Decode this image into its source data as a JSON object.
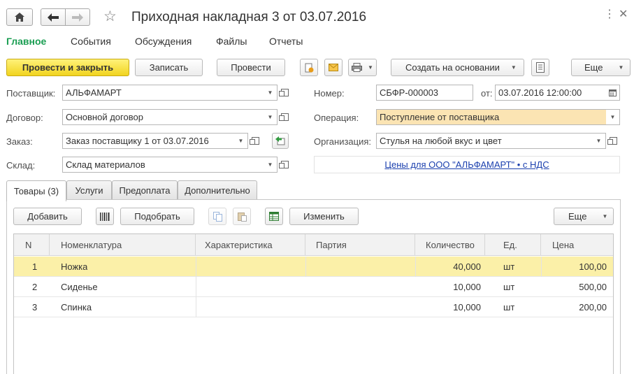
{
  "window": {
    "title": "Приходная накладная 3 от 03.07.2016"
  },
  "top_tabs": [
    "Главное",
    "События",
    "Обсуждения",
    "Файлы",
    "Отчеты"
  ],
  "toolbar": {
    "post_close": "Провести и закрыть",
    "save": "Записать",
    "post": "Провести",
    "create_based": "Создать на основании",
    "more": "Еще"
  },
  "form": {
    "supplier_label": "Поставщик:",
    "supplier_value": "АЛЬФАМАРТ",
    "contract_label": "Договор:",
    "contract_value": "Основной договор",
    "order_label": "Заказ:",
    "order_value": "Заказ поставщику 1 от 03.07.2016",
    "warehouse_label": "Склад:",
    "warehouse_value": "Склад материалов",
    "number_label": "Номер:",
    "number_value": "СБФР-000003",
    "date_label": "от:",
    "date_value": "03.07.2016 12:00:00",
    "operation_label": "Операция:",
    "operation_value": "Поступление от поставщика",
    "organization_label": "Организация:",
    "organization_value": "Стулья на любой вкус и цвет",
    "prices_link": "Цены для ООО \"АЛЬФАМАРТ\" • с НДС"
  },
  "tabs": [
    "Товары (3)",
    "Услуги",
    "Предоплата",
    "Дополнительно"
  ],
  "goods_toolbar": {
    "add": "Добавить",
    "pick": "Подобрать",
    "change": "Изменить",
    "more": "Еще"
  },
  "table": {
    "columns": [
      "N",
      "Номенклатура",
      "Характеристика",
      "Партия",
      "Количество",
      "Ед.",
      "Цена"
    ],
    "rows": [
      {
        "n": "1",
        "item": "Ножка",
        "char": "",
        "batch": "",
        "qty": "40,000",
        "unit": "шт",
        "price": "100,00"
      },
      {
        "n": "2",
        "item": "Сиденье",
        "char": "",
        "batch": "",
        "qty": "10,000",
        "unit": "шт",
        "price": "500,00"
      },
      {
        "n": "3",
        "item": "Спинка",
        "char": "",
        "batch": "",
        "qty": "10,000",
        "unit": "шт",
        "price": "200,00"
      }
    ]
  },
  "colors": {
    "accent_green": "#1a9e52",
    "primary_yellow": "#f1d41f",
    "selected_row": "#fbf0a8",
    "highlight_field": "#fbe4b3",
    "link": "#1a3fae"
  },
  "icons": [
    "home-icon",
    "back-arrow-icon",
    "forward-arrow-icon",
    "star-icon",
    "more-vertical-icon",
    "close-icon",
    "attach-icon",
    "mail-icon",
    "print-icon",
    "report-icon",
    "calendar-icon",
    "barcode-icon",
    "copy-icon",
    "paste-icon",
    "excel-icon"
  ]
}
